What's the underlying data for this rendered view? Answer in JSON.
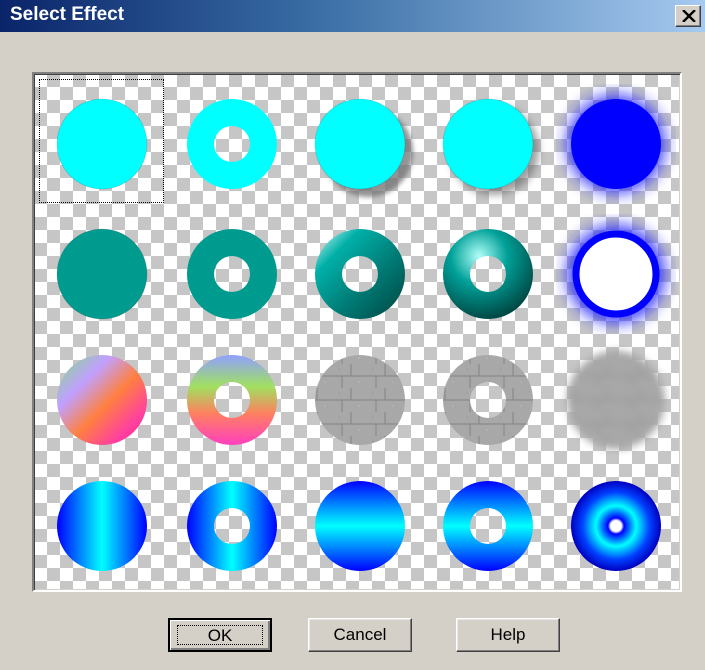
{
  "window": {
    "title": "Select Effect"
  },
  "buttons": {
    "ok": "OK",
    "cancel": "Cancel",
    "help": "Help"
  },
  "effects": {
    "rows": 4,
    "columns": 5,
    "selected_index": 0,
    "items": [
      {
        "row": 1,
        "col": 1,
        "shape": "solid-circle",
        "fill": "#00ffff",
        "style": "flat"
      },
      {
        "row": 1,
        "col": 2,
        "shape": "ring",
        "fill": "#00ffff",
        "style": "flat"
      },
      {
        "row": 1,
        "col": 3,
        "shape": "solid-circle",
        "fill": "#00ffff",
        "style": "drop-shadow"
      },
      {
        "row": 1,
        "col": 4,
        "shape": "solid-circle",
        "fill": "#00ffff",
        "style": "soft-shadow"
      },
      {
        "row": 1,
        "col": 5,
        "shape": "solid-circle",
        "fill": "#0000ff",
        "style": "glow"
      },
      {
        "row": 2,
        "col": 1,
        "shape": "solid-circle",
        "fill": "#009b8f",
        "style": "flat"
      },
      {
        "row": 2,
        "col": 2,
        "shape": "ring",
        "fill": "#009b8f",
        "style": "flat"
      },
      {
        "row": 2,
        "col": 3,
        "shape": "ring",
        "fill": "#009b8f",
        "style": "metallic-bevel"
      },
      {
        "row": 2,
        "col": 4,
        "shape": "ring",
        "fill": "#009b8f",
        "style": "torus"
      },
      {
        "row": 2,
        "col": 5,
        "shape": "ring",
        "fill": "#0000ff",
        "style": "glow"
      },
      {
        "row": 3,
        "col": 1,
        "shape": "solid-circle",
        "fill": "rainbow",
        "style": "gradient"
      },
      {
        "row": 3,
        "col": 2,
        "shape": "ring",
        "fill": "rainbow",
        "style": "gradient"
      },
      {
        "row": 3,
        "col": 3,
        "shape": "solid-circle",
        "fill": "#a0a0a0",
        "style": "stone-texture"
      },
      {
        "row": 3,
        "col": 4,
        "shape": "ring",
        "fill": "#a0a0a0",
        "style": "stone-texture"
      },
      {
        "row": 3,
        "col": 5,
        "shape": "solid-circle",
        "fill": "#a0a0a0",
        "style": "blurred-texture"
      },
      {
        "row": 4,
        "col": 1,
        "shape": "solid-circle",
        "fill": "#0080ff",
        "style": "vertical-gradient"
      },
      {
        "row": 4,
        "col": 2,
        "shape": "ring",
        "fill": "#0080ff",
        "style": "vertical-gradient"
      },
      {
        "row": 4,
        "col": 3,
        "shape": "solid-circle",
        "fill": "#0080ff",
        "style": "horizontal-gradient"
      },
      {
        "row": 4,
        "col": 4,
        "shape": "ring",
        "fill": "#0080ff",
        "style": "horizontal-gradient"
      },
      {
        "row": 4,
        "col": 5,
        "shape": "solid-circle",
        "fill": "#0000ff",
        "style": "radial-rings"
      }
    ]
  }
}
